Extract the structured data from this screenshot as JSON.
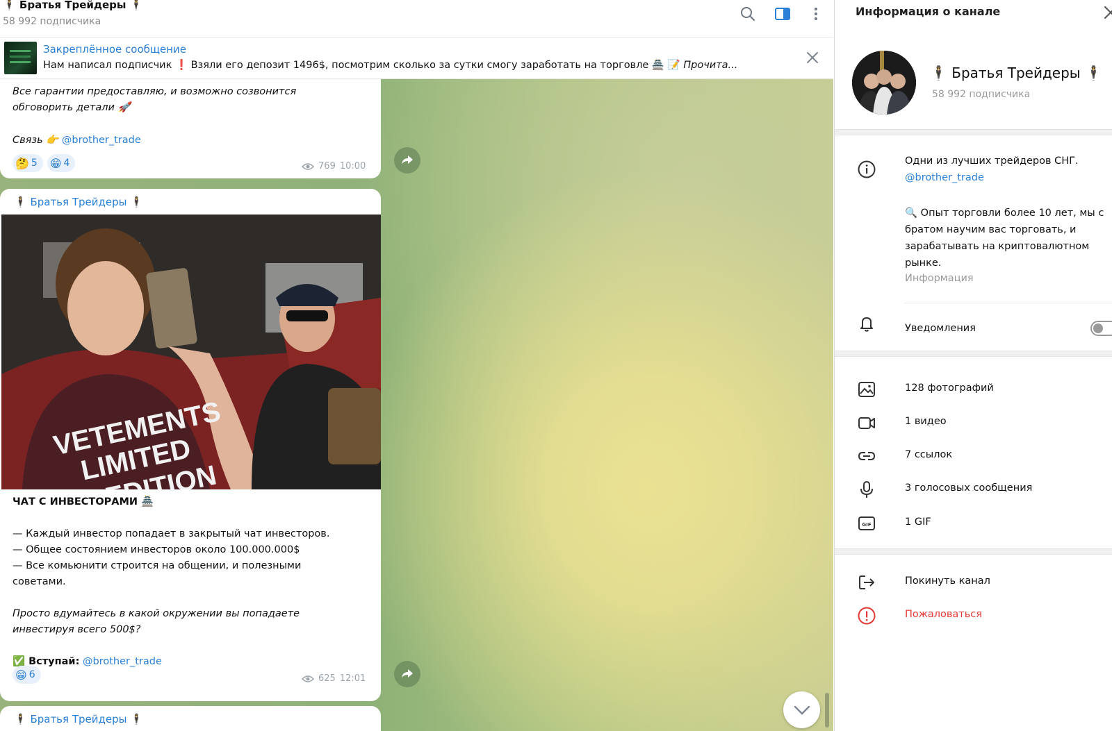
{
  "chat": {
    "title": "🕴 Братья Трейдеры 🕴",
    "subscribers": "58 992 подписчика",
    "pinned": {
      "label": "Закреплённое сообщение",
      "text_main": "Нам написал подписчик ❗ Взяли его депозит 1496$, посмотрим сколько за сутки смогу заработать на торговле 🏯 📝 ",
      "text_more": "Прочита..."
    },
    "messages": [
      {
        "text_line1": "Все гарантии предоставляю, и возможно созвонится",
        "text_line2": "обговорить детали 🚀",
        "contact_label": "Связь 👉",
        "contact_handle": "@brother_trade",
        "reactions": [
          {
            "emoji": "🤔",
            "count": "5"
          },
          {
            "emoji": "😁",
            "count": "4"
          }
        ],
        "views": "769",
        "time": "10:00"
      },
      {
        "author": "🕴 Братья Трейдеры 🕴",
        "photo_caption_overlay": "VETEMENTS LIMITED EDITION",
        "heading": "ЧАТ С ИНВЕСТОРАМИ 🏯",
        "bullets": [
          "— Каждый инвестор попадает в закрытый чат инвесторов.",
          "— Общее состоянием инвесторов около 100.000.000$",
          "— Все комьюнити строится на общении, и полезными",
          "советами."
        ],
        "italic_line1": "Просто вдумайтесь в какой окружении вы попадаете",
        "italic_line2": "инвестируя всего 500$?",
        "join_label": "✅ Вступай:",
        "join_handle": "@brother_trade",
        "reactions": [
          {
            "emoji": "😁",
            "count": "6"
          }
        ],
        "views": "625",
        "time": "12:01"
      },
      {
        "author": "🕴 Братья Трейдеры 🕴"
      }
    ]
  },
  "panel": {
    "title": "Информация о канале",
    "channel_name": "🕴 Братья Трейдеры 🕴",
    "subscribers": "58 992 подписчика",
    "about_line1": "Одни из лучших трейдеров СНГ.",
    "about_link": "@brother_trade",
    "about_desc": "🔍 Опыт торговли более 10 лет, мы с братом научим вас торговать, и зарабатывать на криптовалютном рынке.",
    "about_caption": "Информация",
    "notifications_label": "Уведомления",
    "notifications_on": false,
    "media": [
      {
        "icon": "photo-icon",
        "label": "128 фотографий"
      },
      {
        "icon": "video-icon",
        "label": "1 видео"
      },
      {
        "icon": "link-icon",
        "label": "7 ссылок"
      },
      {
        "icon": "mic-icon",
        "label": "3 голосовых сообщения"
      },
      {
        "icon": "gif-icon",
        "label": "1 GIF"
      }
    ],
    "leave_label": "Покинуть канал",
    "report_label": "Пожаловаться"
  },
  "colors": {
    "accent": "#2a7fd6",
    "danger": "#e53935",
    "reaction_bg": "#e8f1fb"
  }
}
